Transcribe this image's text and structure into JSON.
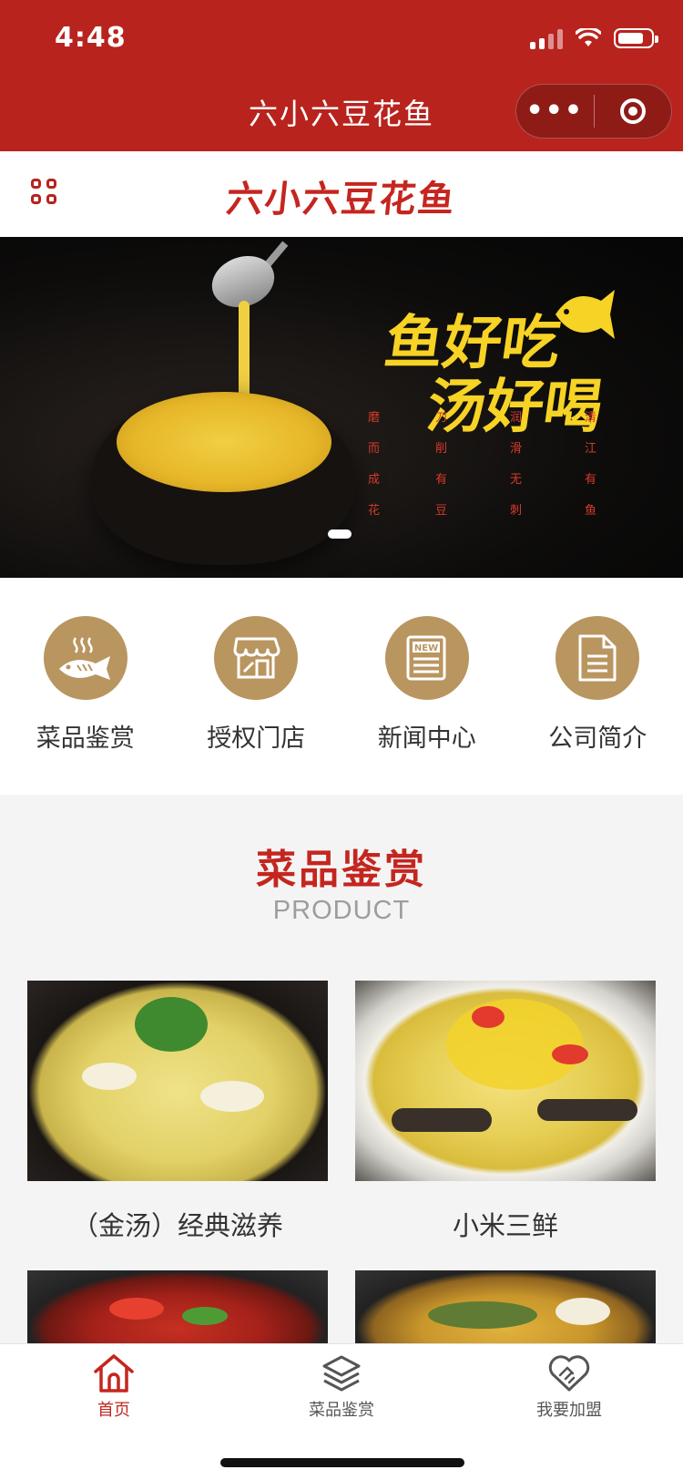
{
  "status_bar": {
    "time": "4:48",
    "battery_level": 0.8
  },
  "nav": {
    "title": "六小六豆花鱼",
    "more_label": "•••"
  },
  "header": {
    "logo_text": "六小六豆花鱼"
  },
  "banner": {
    "slogan_line1": "鱼好吃",
    "slogan_line2": "汤好喝",
    "poem_columns": [
      "磨而成花",
      "刀削有豆",
      "润滑无刺",
      "清江有鱼"
    ],
    "slide_count": 1,
    "active_slide": 1
  },
  "quick_nav": [
    {
      "label": "菜品鉴赏",
      "icon": "fish-icon"
    },
    {
      "label": "授权门店",
      "icon": "store-icon"
    },
    {
      "label": "新闻中心",
      "icon": "newspaper-icon"
    },
    {
      "label": "公司简介",
      "icon": "document-icon"
    }
  ],
  "product_section": {
    "title": "菜品鉴赏",
    "subtitle": "PRODUCT",
    "items": [
      {
        "name": "（金汤）经典滋养"
      },
      {
        "name": "小米三鲜"
      },
      {
        "name": ""
      },
      {
        "name": ""
      }
    ]
  },
  "tab_bar": [
    {
      "label": "首页",
      "icon": "home-icon",
      "active": true
    },
    {
      "label": "菜品鉴赏",
      "icon": "layers-icon",
      "active": false
    },
    {
      "label": "我要加盟",
      "icon": "handshake-icon",
      "active": false
    }
  ],
  "colors": {
    "brand_red": "#b8231e",
    "accent_gold": "#b99560",
    "text_red": "#c4261f"
  }
}
